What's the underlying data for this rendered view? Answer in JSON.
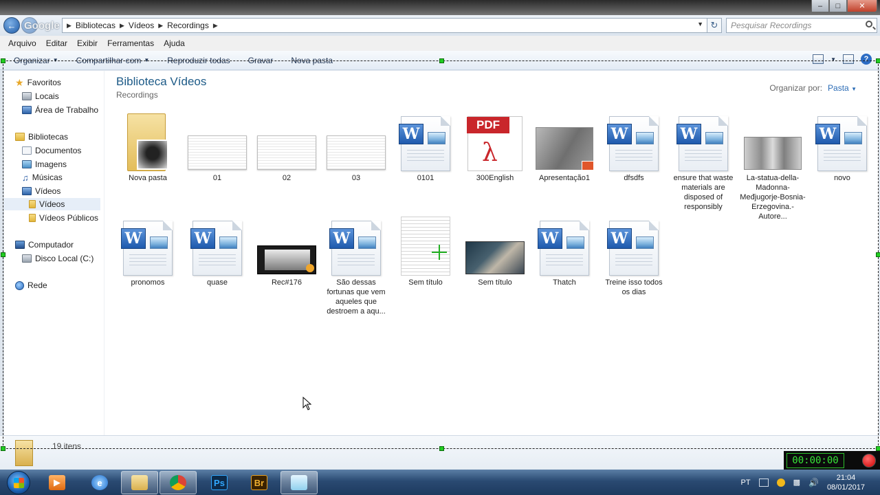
{
  "breadcrumb": [
    "Bibliotecas",
    "Vídeos",
    "Recordings"
  ],
  "watermark": "Google",
  "search": {
    "placeholder": "Pesquisar Recordings"
  },
  "menu": [
    "Arquivo",
    "Editar",
    "Exibir",
    "Ferramentas",
    "Ajuda"
  ],
  "commands": [
    "Organizar",
    "Compartilhar com",
    "Reproduzir todas",
    "Gravar",
    "Nova pasta"
  ],
  "nav": {
    "favoritos": "Favoritos",
    "locais": "Locais",
    "area_trabalho": "Área de Trabalho",
    "bibliotecas": "Bibliotecas",
    "documentos": "Documentos",
    "imagens": "Imagens",
    "musicas": "Músicas",
    "videos": "Vídeos",
    "videos_sub": "Vídeos",
    "videos_publicos": "Vídeos Públicos",
    "computador": "Computador",
    "disco_local": "Disco Local (C:)",
    "rede": "Rede"
  },
  "library": {
    "title": "Biblioteca Vídeos",
    "subtitle": "Recordings",
    "arrange_label": "Organizar por:",
    "arrange_value": "Pasta"
  },
  "files": [
    {
      "label": "Nova pasta",
      "icon": "folder-icon"
    },
    {
      "label": "01",
      "icon": "screenshot-thumbnail"
    },
    {
      "label": "02",
      "icon": "screenshot-thumbnail"
    },
    {
      "label": "03",
      "icon": "screenshot-thumbnail"
    },
    {
      "label": "0101",
      "icon": "word-icon"
    },
    {
      "label": "300English",
      "icon": "pdf-icon"
    },
    {
      "label": "Apresentação1",
      "icon": "video-thumbnail"
    },
    {
      "label": "dfsdfs",
      "icon": "word-icon"
    },
    {
      "label": "ensure that waste materials are disposed of responsibly",
      "icon": "word-icon"
    },
    {
      "label": "La-statua-della-Madonna-Međjugorje-Bosnia-Erzegovina.-Autore...",
      "icon": "photo-thumbnail"
    },
    {
      "label": "novo",
      "icon": "word-icon"
    },
    {
      "label": "pronomos",
      "icon": "word-icon"
    },
    {
      "label": "quase",
      "icon": "word-icon"
    },
    {
      "label": "Rec#176",
      "icon": "video-thumbnail"
    },
    {
      "label": "São dessas fortunas que vem aqueles que destroem a aqu...",
      "icon": "word-icon"
    },
    {
      "label": "Sem título",
      "icon": "document-thumbnail"
    },
    {
      "label": "Sem título",
      "icon": "video-thumbnail"
    },
    {
      "label": "Thatch",
      "icon": "word-icon"
    },
    {
      "label": "Treine isso todos os dias",
      "icon": "word-icon"
    }
  ],
  "status": {
    "count": "19 itens"
  },
  "recorder": {
    "timer": "00:00:00"
  },
  "taskbar": {
    "apps": [
      "media-player",
      "internet-explorer",
      "file-explorer",
      "chrome",
      "photoshop",
      "bridge",
      "notepad"
    ],
    "ps_label": "Ps",
    "br_label": "Br"
  },
  "tray": {
    "lang": "PT",
    "time": "21:04",
    "date": "08/01/2017"
  },
  "colors": {
    "link": "#2a6bb5",
    "title": "#1c5a87",
    "timer": "#39e639"
  }
}
